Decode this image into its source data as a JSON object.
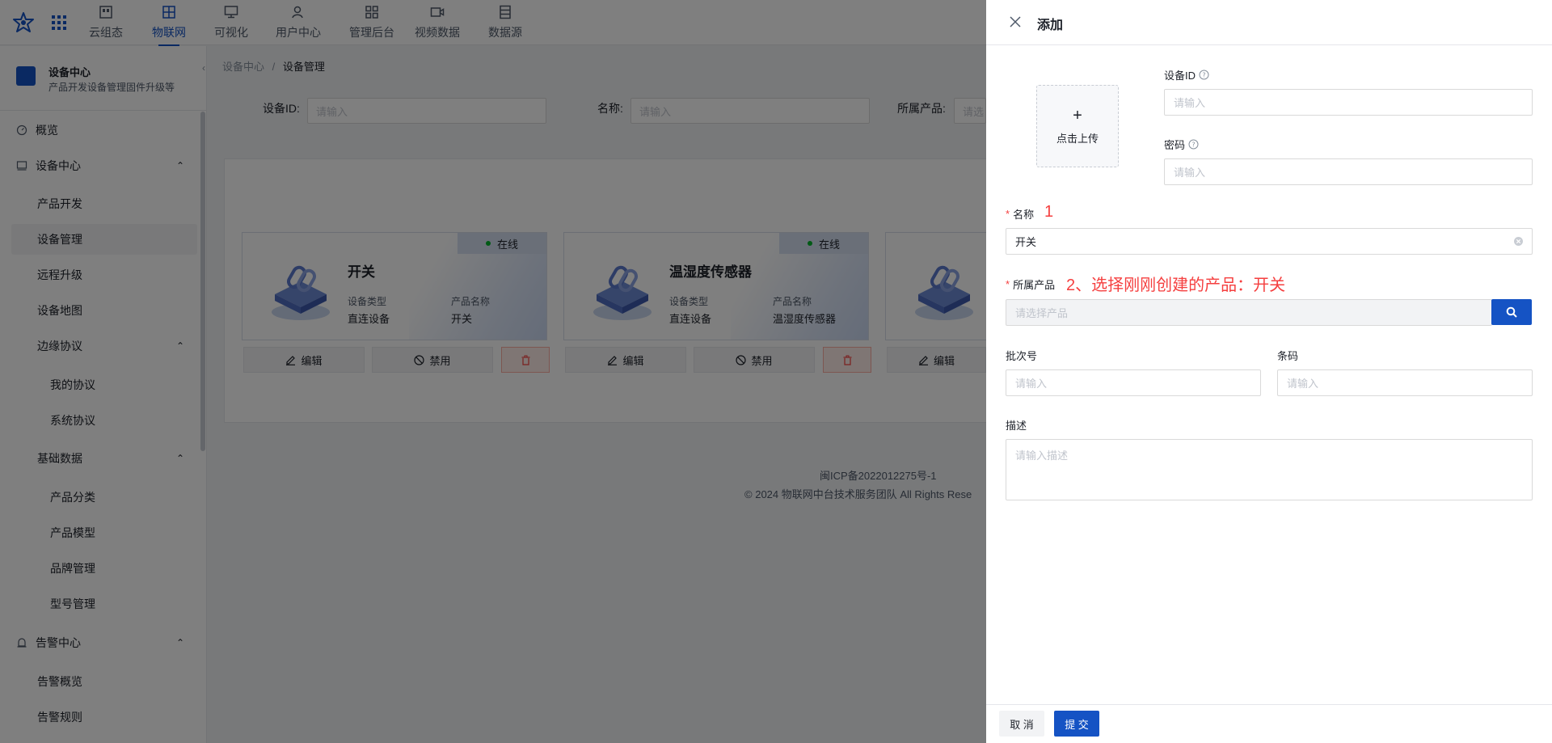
{
  "nav": {
    "items": [
      {
        "label": "云组态",
        "icon": "dashboard-icon"
      },
      {
        "label": "物联网",
        "icon": "iot-grid-icon",
        "active": true
      },
      {
        "label": "可视化",
        "icon": "monitor-icon"
      },
      {
        "label": "用户中心",
        "icon": "user-icon"
      },
      {
        "label": "管理后台",
        "icon": "grid-icon"
      },
      {
        "label": "视频数据",
        "icon": "video-icon"
      },
      {
        "label": "数据源",
        "icon": "database-icon"
      }
    ]
  },
  "sidebar": {
    "title": "设备中心",
    "subtitle": "产品开发设备管理固件升级等",
    "items": [
      {
        "label": "概览",
        "level": 0,
        "icon": "gauge-icon"
      },
      {
        "label": "设备中心",
        "level": 0,
        "icon": "device-icon",
        "expanded": true
      },
      {
        "label": "产品开发",
        "level": 1
      },
      {
        "label": "设备管理",
        "level": 1,
        "active": true
      },
      {
        "label": "远程升级",
        "level": 1
      },
      {
        "label": "设备地图",
        "level": 1
      },
      {
        "label": "边缘协议",
        "level": 1,
        "expanded": true
      },
      {
        "label": "我的协议",
        "level": 2
      },
      {
        "label": "系统协议",
        "level": 2
      },
      {
        "label": "基础数据",
        "level": 1,
        "expanded": true
      },
      {
        "label": "产品分类",
        "level": 2
      },
      {
        "label": "产品模型",
        "level": 2
      },
      {
        "label": "品牌管理",
        "level": 2
      },
      {
        "label": "型号管理",
        "level": 2
      },
      {
        "label": "告警中心",
        "level": 0,
        "icon": "alarm-icon",
        "expanded": true
      },
      {
        "label": "告警概览",
        "level": 1
      },
      {
        "label": "告警规则",
        "level": 1
      }
    ]
  },
  "breadcrumb": {
    "parent": "设备中心",
    "separator": "/",
    "current": "设备管理"
  },
  "filters": {
    "device_id_label": "设备ID:",
    "device_id_placeholder": "请输入",
    "name_label": "名称:",
    "name_placeholder": "请输入",
    "product_label": "所属产品:",
    "product_placeholder": "请选"
  },
  "cards": [
    {
      "name": "开关",
      "status": "在线",
      "type_label": "设备类型",
      "type": "直连设备",
      "product_label": "产品名称",
      "product": "开关"
    },
    {
      "name": "温湿度传感器",
      "status": "在线",
      "type_label": "设备类型",
      "type": "直连设备",
      "product_label": "产品名称",
      "product": "温湿度传感器"
    }
  ],
  "card_actions": {
    "edit": "编辑",
    "disable": "禁用"
  },
  "footer": {
    "icp": "闽ICP备2022012275号-1",
    "copyright": "2024 物联网中台技术服务团队 All Rights Rese"
  },
  "drawer": {
    "title": "添加",
    "upload_label": "点击上传",
    "device_id_label": "设备ID",
    "device_id_placeholder": "请输入",
    "password_label": "密码",
    "password_placeholder": "请输入",
    "name_label": "名称",
    "name_value": "开关",
    "name_annotation": "1",
    "product_label": "所属产品",
    "product_annotation": "2、选择刚刚创建的产品：开关",
    "product_placeholder": "请选择产品",
    "batch_label": "批次号",
    "batch_placeholder": "请输入",
    "barcode_label": "条码",
    "barcode_placeholder": "请输入",
    "desc_label": "描述",
    "desc_placeholder": "请输入描述",
    "cancel": "取 消",
    "submit": "提 交"
  },
  "colors": {
    "primary": "#1553c4",
    "danger": "#f53f3f",
    "online": "#00b42a"
  }
}
